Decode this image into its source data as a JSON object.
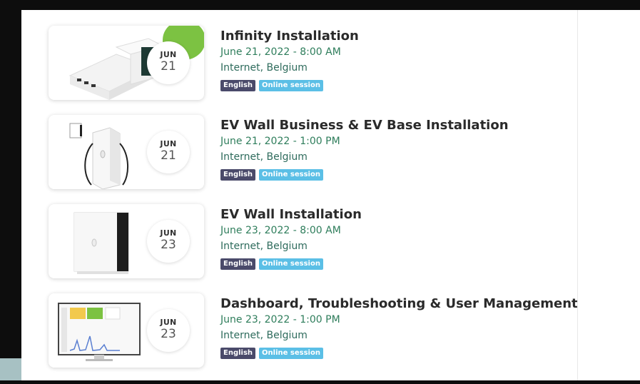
{
  "events": [
    {
      "title": "Infinity Installation",
      "datetime": "June 21, 2022 - 8:00 AM",
      "location": "Internet, Belgium",
      "month": "JUN",
      "day": "21",
      "tags": [
        "English",
        "Online session"
      ],
      "image_icon": "inverter-box-image"
    },
    {
      "title": "EV Wall Business & EV Base Installation",
      "datetime": "June 21, 2022 - 1:00 PM",
      "location": "Internet, Belgium",
      "month": "JUN",
      "day": "21",
      "tags": [
        "English",
        "Online session"
      ],
      "image_icon": "ev-charger-image"
    },
    {
      "title": "EV Wall Installation",
      "datetime": "June 23, 2022 - 8:00 AM",
      "location": "Internet, Belgium",
      "month": "JUN",
      "day": "23",
      "tags": [
        "English",
        "Online session"
      ],
      "image_icon": "wall-box-image"
    },
    {
      "title": "Dashboard, Troubleshooting & User Management",
      "datetime": "June 23, 2022 - 1:00 PM",
      "location": "Internet, Belgium",
      "month": "JUN",
      "day": "23",
      "tags": [
        "English",
        "Online session"
      ],
      "image_icon": "monitor-dashboard-image"
    }
  ],
  "colors": {
    "title": "#2a2a2a",
    "datetime": "#2e7d5b",
    "tag_language": "#4a4a6a",
    "tag_session": "#5bbfe6",
    "frame": "#0d0d0d"
  }
}
